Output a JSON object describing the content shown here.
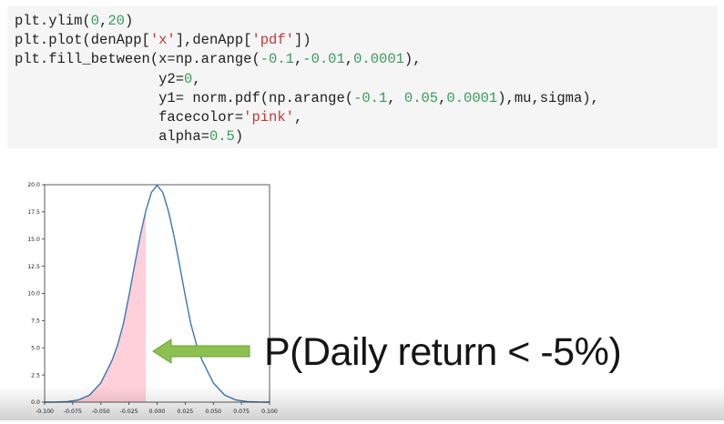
{
  "code_cell": {
    "lines": [
      [
        {
          "t": "plt.ylim(",
          "c": ""
        },
        {
          "t": "0",
          "c": "num"
        },
        {
          "t": ",",
          "c": ""
        },
        {
          "t": "20",
          "c": "num"
        },
        {
          "t": ")",
          "c": ""
        }
      ],
      [
        {
          "t": "plt.plot(denApp[",
          "c": ""
        },
        {
          "t": "'x'",
          "c": "str"
        },
        {
          "t": "],denApp[",
          "c": ""
        },
        {
          "t": "'pdf'",
          "c": "str"
        },
        {
          "t": "])",
          "c": ""
        }
      ],
      [
        {
          "t": "plt.fill_between(x=np.arange(",
          "c": ""
        },
        {
          "t": "-0.1",
          "c": "num"
        },
        {
          "t": ",",
          "c": ""
        },
        {
          "t": "-0.01",
          "c": "num"
        },
        {
          "t": ",",
          "c": ""
        },
        {
          "t": "0.0001",
          "c": "num"
        },
        {
          "t": "),",
          "c": ""
        }
      ],
      [
        {
          "t": "                 y2=",
          "c": ""
        },
        {
          "t": "0",
          "c": "num"
        },
        {
          "t": ",",
          "c": ""
        }
      ],
      [
        {
          "t": "                 y1= norm.pdf(np.arange(",
          "c": ""
        },
        {
          "t": "-0.1",
          "c": "num"
        },
        {
          "t": ", ",
          "c": ""
        },
        {
          "t": "0.05",
          "c": "num"
        },
        {
          "t": ",",
          "c": ""
        },
        {
          "t": "0.0001",
          "c": "num"
        },
        {
          "t": "),mu,sigma),",
          "c": ""
        }
      ],
      [
        {
          "t": "                 facecolor=",
          "c": ""
        },
        {
          "t": "'pink'",
          "c": "str"
        },
        {
          "t": ",",
          "c": ""
        }
      ],
      [
        {
          "t": "                 alpha=",
          "c": ""
        },
        {
          "t": "0.5",
          "c": "num"
        },
        {
          "t": ")",
          "c": ""
        }
      ]
    ]
  },
  "annotation": {
    "text": "P(Daily return < -5%)",
    "arrow_color": "#8cc152"
  },
  "colors": {
    "curve": "#3a78b0",
    "fill": "#ffd0da",
    "code_bg": "#f5f5f5",
    "code_number": "#3a9b5c",
    "code_string": "#c23a3a"
  },
  "chart_data": {
    "type": "area",
    "title": "",
    "xlabel": "",
    "ylabel": "",
    "xlim": [
      -0.1,
      0.1
    ],
    "ylim": [
      0,
      20
    ],
    "grid": false,
    "x_ticks": [
      "-0.100",
      "-0.075",
      "-0.050",
      "-0.025",
      "0.000",
      "0.025",
      "0.050",
      "0.075",
      "0.100"
    ],
    "y_ticks": [
      "0.0",
      "2.5",
      "5.0",
      "7.5",
      "10.0",
      "12.5",
      "15.0",
      "17.5",
      "20.0"
    ],
    "x_tick_values": [
      -0.1,
      -0.075,
      -0.05,
      -0.025,
      0,
      0.025,
      0.05,
      0.075,
      0.1
    ],
    "y_tick_values": [
      0,
      2.5,
      5,
      7.5,
      10,
      12.5,
      15,
      17.5,
      20
    ],
    "curve": {
      "x": [
        -0.1,
        -0.09,
        -0.08,
        -0.07,
        -0.06,
        -0.05,
        -0.04,
        -0.035,
        -0.03,
        -0.025,
        -0.02,
        -0.015,
        -0.01,
        -0.005,
        0,
        0.005,
        0.01,
        0.015,
        0.02,
        0.025,
        0.03,
        0.035,
        0.04,
        0.05,
        0.06,
        0.07,
        0.08,
        0.09,
        0.1
      ],
      "y": [
        0,
        0.01,
        0.05,
        0.2,
        0.66,
        1.77,
        3.85,
        5.3,
        7.2,
        9.8,
        12.6,
        15.3,
        17.6,
        19.3,
        19.95,
        19.3,
        17.6,
        15.3,
        12.6,
        9.8,
        7.2,
        5.3,
        3.85,
        1.77,
        0.66,
        0.2,
        0.05,
        0.01,
        0
      ]
    },
    "fill": {
      "x_from": -0.1,
      "x_to": -0.01,
      "y2": 0
    }
  }
}
